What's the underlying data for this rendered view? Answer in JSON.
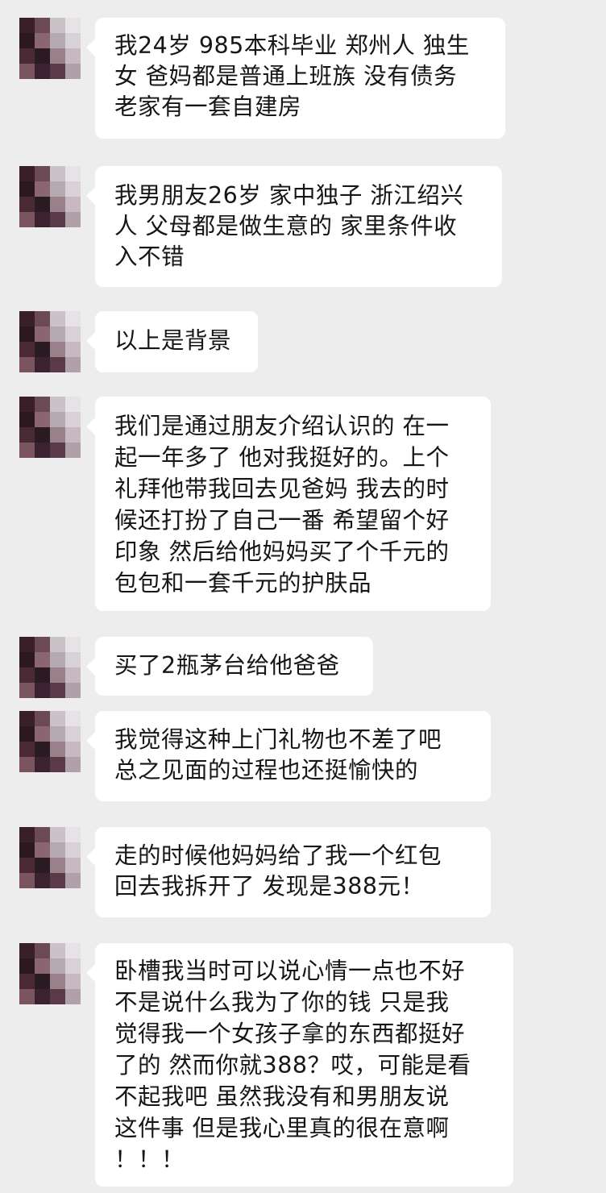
{
  "chat": {
    "messages": [
      {
        "lines": [
          "我24岁 985本科毕业 郑州人 独生",
          "女 爸妈都是普通上班族 没有债务",
          "老家有一套自建房"
        ]
      },
      {
        "lines": [
          "我男朋友26岁 家中独子 浙江绍兴",
          "人 父母都是做生意的 家里条件收",
          "入不错"
        ]
      },
      {
        "lines": [
          "以上是背景"
        ]
      },
      {
        "lines": [
          "我们是通过朋友介绍认识的 在一",
          "起一年多了 他对我挺好的。上个",
          "礼拜他带我回去见爸妈 我去的时",
          "候还打扮了自己一番 希望留个好",
          "印象 然后给他妈妈买了个千元的",
          "包包和一套千元的护肤品"
        ]
      },
      {
        "lines": [
          "买了2瓶茅台给他爸爸"
        ]
      },
      {
        "lines": [
          "我觉得这种上门礼物也不差了吧",
          "总之见面的过程也还挺愉快的"
        ]
      },
      {
        "lines": [
          "走的时候他妈妈给了我一个红包",
          "回去我拆开了 发现是388元！"
        ]
      },
      {
        "lines": [
          "卧槽我当时可以说心情一点也不好",
          " 不是说什么我为了你的钱 只是我",
          "觉得我一个女孩子拿的东西都挺好",
          "了的 然而你就388？哎，可能是看",
          "不起我吧 虽然我没有和男朋友说",
          "这件事 但是我心里真的很在意啊",
          "！！！"
        ]
      }
    ]
  },
  "colors": {
    "background": "#ededed",
    "bubble": "#ffffff",
    "text": "#161616"
  },
  "icons": {
    "avatar": "pixelated-avatar-icon"
  }
}
